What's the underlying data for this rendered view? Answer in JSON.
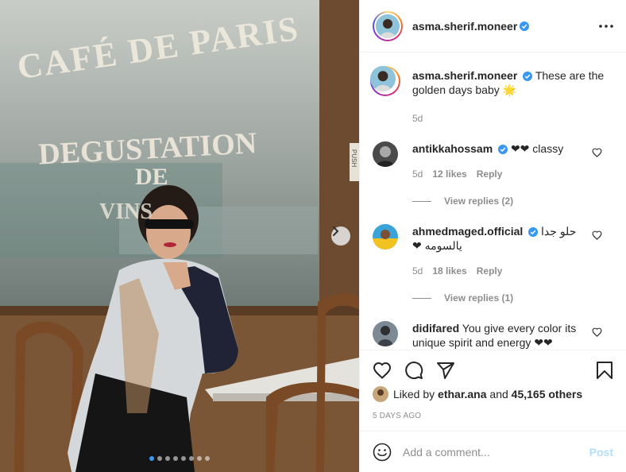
{
  "photo": {
    "sign_line1": "CAFÉ DE PARIS",
    "sign_line2": "DEGUSTATION",
    "sign_line3": "DE",
    "sign_line4": "VINS",
    "door_text": "PUSH",
    "carousel_total": 8,
    "carousel_active": 1
  },
  "post": {
    "author": "asma.sherif.moneer",
    "caption": "These are the golden days baby 🌟",
    "caption_age": "5d"
  },
  "comments": [
    {
      "user": "antikkahossam",
      "verified": true,
      "text": "❤❤ classy",
      "age": "5d",
      "likes": "12 likes",
      "reply_label": "Reply",
      "view_replies": "View replies (2)"
    },
    {
      "user": "ahmedmaged.official",
      "verified": true,
      "text": "حلو جدا يالسومه ❤",
      "age": "5d",
      "likes": "18 likes",
      "reply_label": "Reply",
      "view_replies": "View replies (1)"
    },
    {
      "user": "didifared",
      "verified": false,
      "text": "You give every color its unique spirit and energy ❤❤"
    }
  ],
  "likes": {
    "liked_by_prefix": "Liked by",
    "liked_by_user": "ethar.ana",
    "and": "and",
    "others_count": "45,165 others"
  },
  "date": "5 DAYS AGO",
  "compose": {
    "placeholder": "Add a comment...",
    "post_label": "Post"
  },
  "colors": {
    "accent_blue": "#3897f0",
    "verified_blue": "#3897f0",
    "post_disabled": "#b2dffc",
    "muted_text": "#8e8e8e"
  },
  "icons": [
    "chevron-right-icon",
    "more-icon",
    "verified-icon",
    "heart-icon",
    "comment-icon",
    "share-icon",
    "bookmark-icon",
    "emoji-icon"
  ]
}
